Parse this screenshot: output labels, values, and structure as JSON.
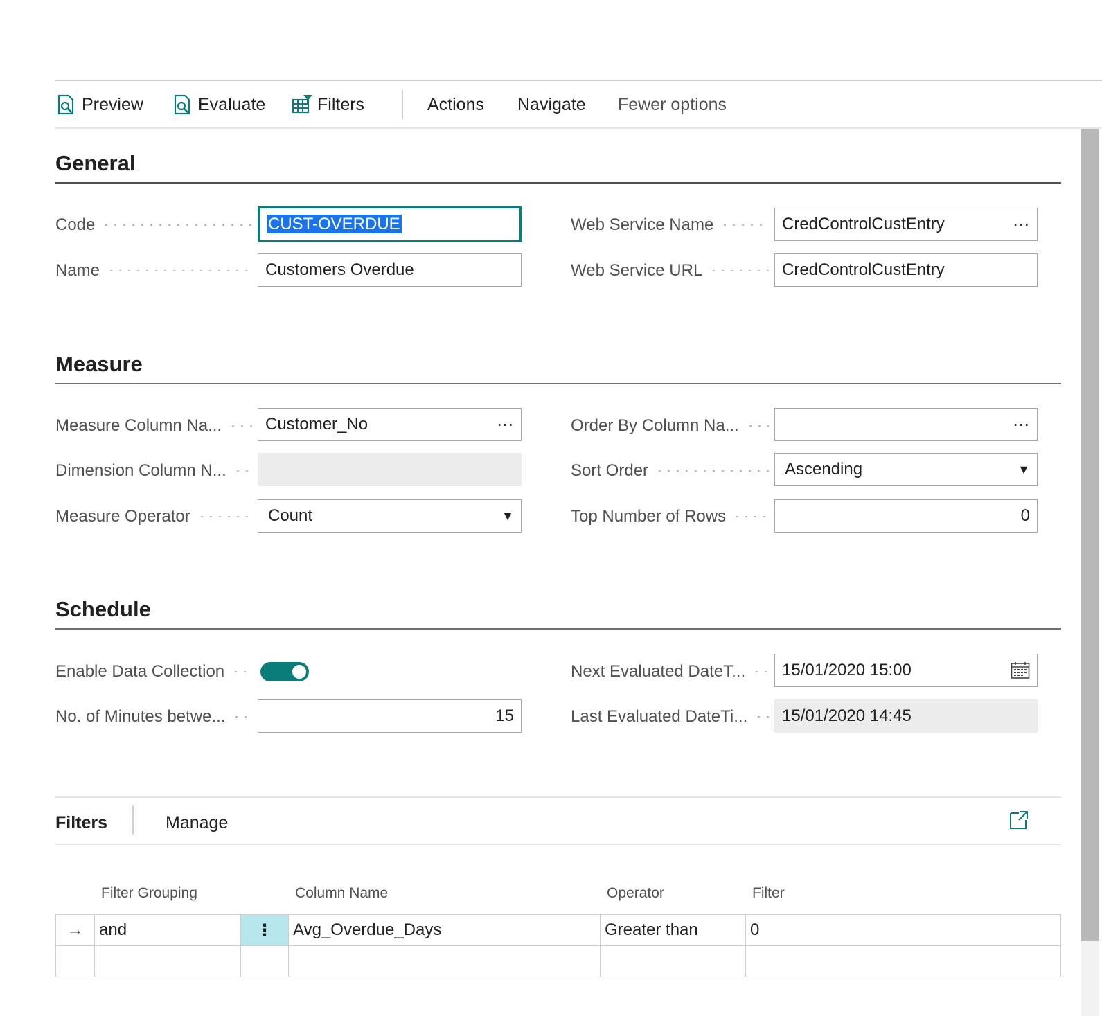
{
  "actionbar": {
    "preview": "Preview",
    "evaluate": "Evaluate",
    "filters": "Filters",
    "actions": "Actions",
    "navigate": "Navigate",
    "fewer_options": "Fewer options"
  },
  "sections": {
    "general": "General",
    "measure": "Measure",
    "schedule": "Schedule"
  },
  "general": {
    "code_label": "Code",
    "code_value": "CUST-OVERDUE",
    "name_label": "Name",
    "name_value": "Customers Overdue",
    "ws_name_label": "Web Service Name",
    "ws_name_value": "CredControlCustEntry",
    "ws_url_label": "Web Service URL",
    "ws_url_value": "CredControlCustEntry"
  },
  "measure": {
    "measure_col_label": "Measure Column Na...",
    "measure_col_value": "Customer_No",
    "dimension_col_label": "Dimension Column N...",
    "dimension_col_value": "",
    "operator_label": "Measure Operator",
    "operator_value": "Count",
    "order_by_label": "Order By Column Na...",
    "order_by_value": "",
    "sort_order_label": "Sort Order",
    "sort_order_value": "Ascending",
    "top_rows_label": "Top Number of Rows",
    "top_rows_value": "0"
  },
  "schedule": {
    "enable_label": "Enable Data Collection",
    "enable_value": true,
    "minutes_label": "No. of Minutes betwe...",
    "minutes_value": "15",
    "next_eval_label": "Next Evaluated DateT...",
    "next_eval_value": "15/01/2020 15:00",
    "last_eval_label": "Last Evaluated DateTi...",
    "last_eval_value": "15/01/2020 14:45"
  },
  "filters_part": {
    "tab_filters": "Filters",
    "tab_manage": "Manage",
    "columns": [
      "Filter Grouping",
      "Column Name",
      "Operator",
      "Filter"
    ],
    "rows": [
      {
        "grouping": "and",
        "column": "Avg_Overdue_Days",
        "operator": "Greater than",
        "filter": "0"
      }
    ]
  },
  "glyphs": {
    "ellipsis": "⋯",
    "caret": "▼",
    "row_arrow": "→",
    "row_menu": "⋮"
  },
  "colors": {
    "accent": "#0a7c79",
    "selection": "#1a73e8",
    "row_menu_bg": "#b7e6ec"
  }
}
